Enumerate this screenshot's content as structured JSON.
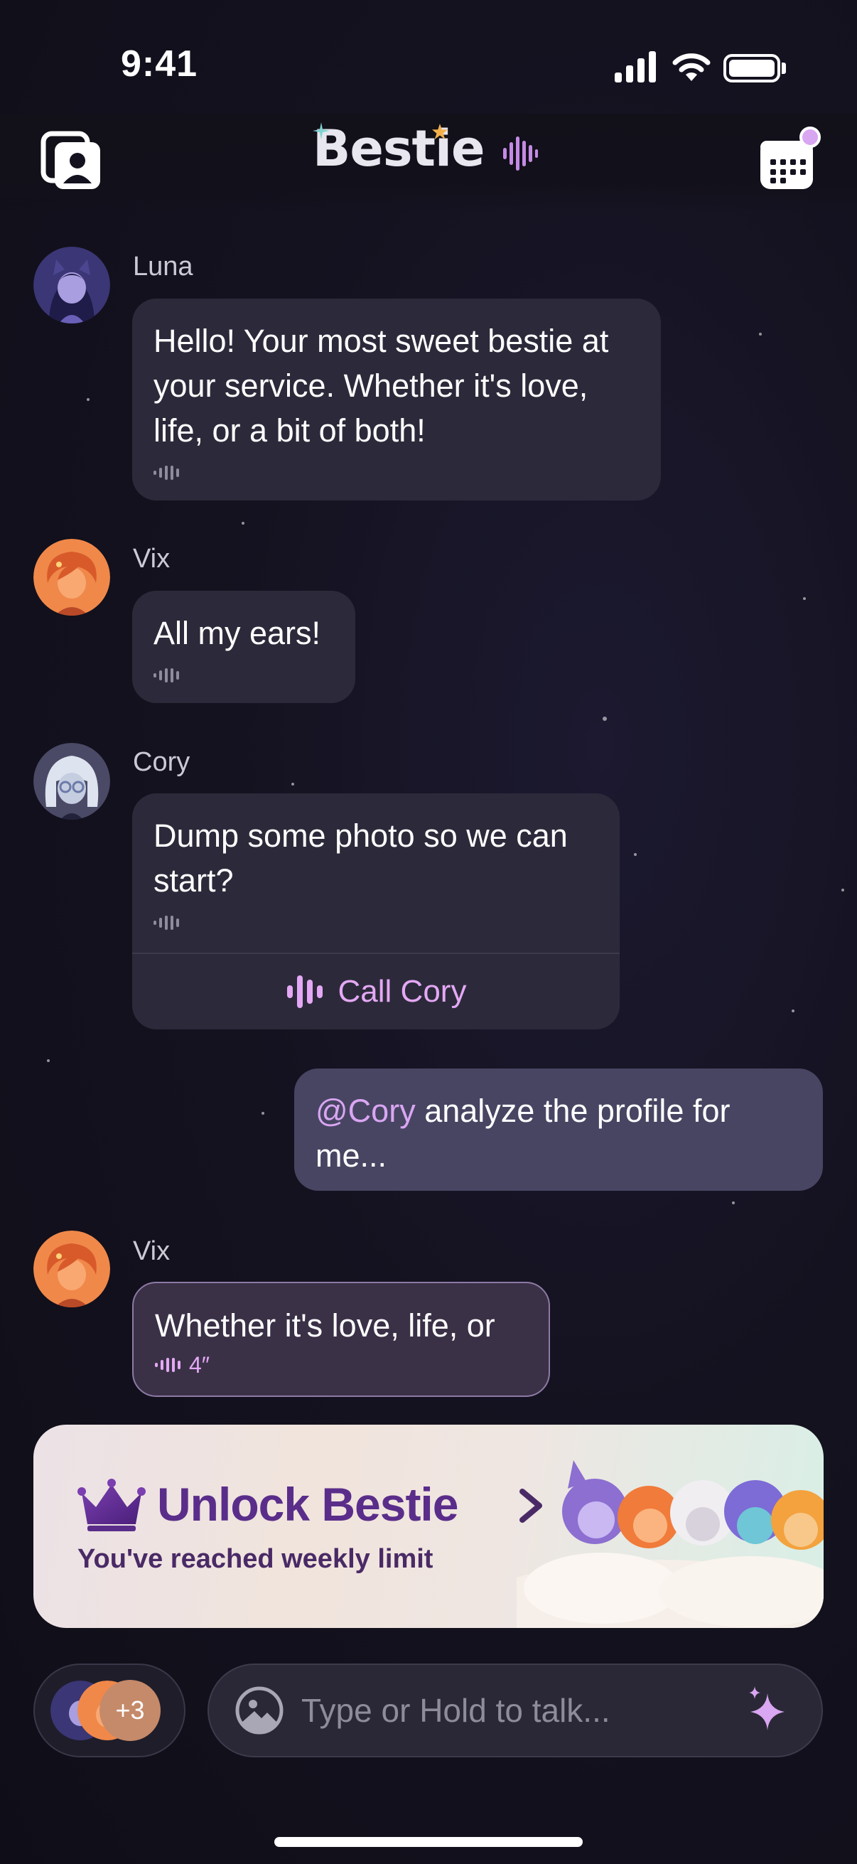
{
  "status_bar": {
    "time": "9:41"
  },
  "header": {
    "title": "Bestie"
  },
  "messages": [
    {
      "sender": "Luna",
      "text": "Hello! Your most sweet bestie at your service. Whether it's love, life, or a bit of both!"
    },
    {
      "sender": "Vix",
      "text": "All my ears!"
    },
    {
      "sender": "Cory",
      "text": "Dump some photo so we can start?",
      "action_label": "Call Cory"
    },
    {
      "mine": true,
      "mention": "@Cory",
      "text": " analyze the profile for me..."
    },
    {
      "sender": "Vix",
      "text": "Whether it's love, life, or",
      "duration": "4″"
    }
  ],
  "banner": {
    "title": "Unlock Bestie",
    "subtitle": "You've reached weekly limit"
  },
  "composer": {
    "placeholder": "Type or Hold to talk...",
    "extra_members": "+3"
  },
  "colors": {
    "accent": "#d9a6f2",
    "bubble": "#2c2a3a",
    "my_bubble": "#484563",
    "banner_title": "#5a2d8a"
  }
}
